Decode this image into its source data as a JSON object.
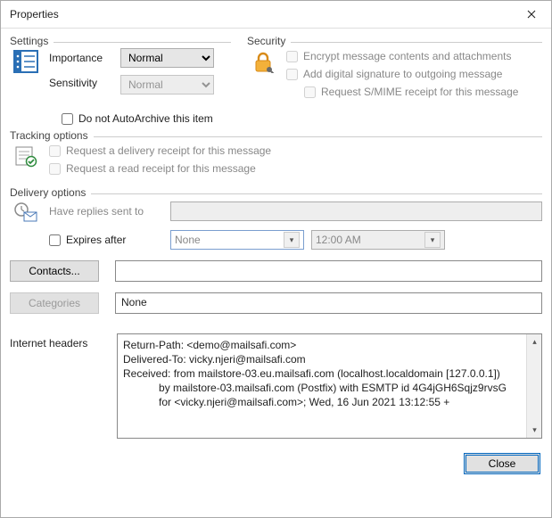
{
  "window": {
    "title": "Properties"
  },
  "settings": {
    "legend": "Settings",
    "importance_label": "Importance",
    "importance_value": "Normal",
    "sensitivity_label": "Sensitivity",
    "sensitivity_value": "Normal",
    "no_autoarchive_label": "Do not AutoArchive this item"
  },
  "security": {
    "legend": "Security",
    "encrypt_label": "Encrypt message contents and attachments",
    "sign_label": "Add digital signature to outgoing message",
    "smime_label": "Request S/MIME receipt for this message"
  },
  "tracking": {
    "legend": "Tracking options",
    "delivery_label": "Request a delivery receipt for this message",
    "read_label": "Request a read receipt for this message"
  },
  "delivery": {
    "legend": "Delivery options",
    "replies_label": "Have replies sent to",
    "expires_label": "Expires after",
    "expires_date": "None",
    "expires_time": "12:00 AM",
    "contacts_btn": "Contacts...",
    "categories_btn": "Categories",
    "categories_value": "None"
  },
  "headers": {
    "label": "Internet headers",
    "text": "Return-Path: <demo@mailsafi.com>\nDelivered-To: vicky.njeri@mailsafi.com\nReceived: from mailstore-03.eu.mailsafi.com (localhost.localdomain [127.0.0.1])\n            by mailstore-03.mailsafi.com (Postfix) with ESMTP id 4G4jGH6Sqjz9rvsG\n            for <vicky.njeri@mailsafi.com>; Wed, 16 Jun 2021 13:12:55 +"
  },
  "footer": {
    "close": "Close"
  }
}
